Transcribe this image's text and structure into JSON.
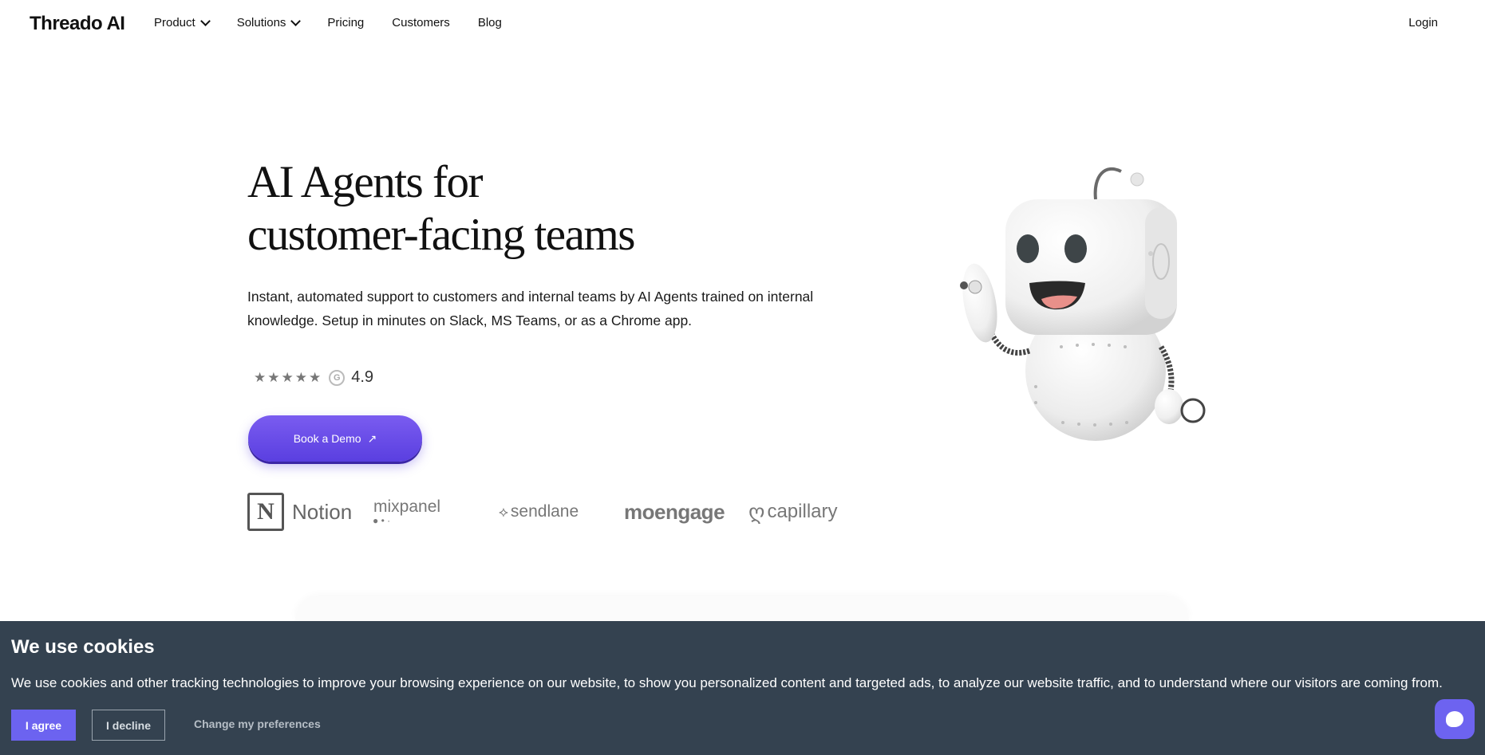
{
  "nav": {
    "logo": "Threado AI",
    "items": [
      {
        "label": "Product",
        "has_dropdown": true
      },
      {
        "label": "Solutions",
        "has_dropdown": true
      },
      {
        "label": "Pricing",
        "has_dropdown": false
      },
      {
        "label": "Customers",
        "has_dropdown": false
      },
      {
        "label": "Blog",
        "has_dropdown": false
      }
    ],
    "login": "Login"
  },
  "hero": {
    "title_line1": "AI Agents for",
    "title_line2": "customer-facing teams",
    "subtitle": "Instant, automated support to customers and internal teams by AI Agents trained on internal knowledge. Setup in minutes on Slack, MS Teams, or as a Chrome app.",
    "rating": {
      "value": "4.9",
      "stars": 5,
      "source_icon": "g2-icon"
    },
    "cta_label": "Book a Demo",
    "cta_icon": "arrow-up-right-icon",
    "illustration": "robot-waving-illustration"
  },
  "logos": {
    "notion_mark": "N",
    "notion": "Notion",
    "mixpanel": "mixpanel",
    "sendlane": "sendlane",
    "moengage": "moengage",
    "capillary": "capillary"
  },
  "cookie": {
    "title": "We use cookies",
    "text": "We use cookies and other tracking technologies to improve your browsing experience on our website, to show you personalized content and targeted ads, to analyze our website traffic, and to understand where our visitors are coming from.",
    "agree": "I agree",
    "decline": "I decline",
    "preferences": "Change my preferences"
  },
  "colors": {
    "accent": "#6c63f0",
    "cookie_bg": "#344250",
    "cta_gradient_top": "#7a5cf0",
    "cta_gradient_bottom": "#5a3fe0"
  }
}
